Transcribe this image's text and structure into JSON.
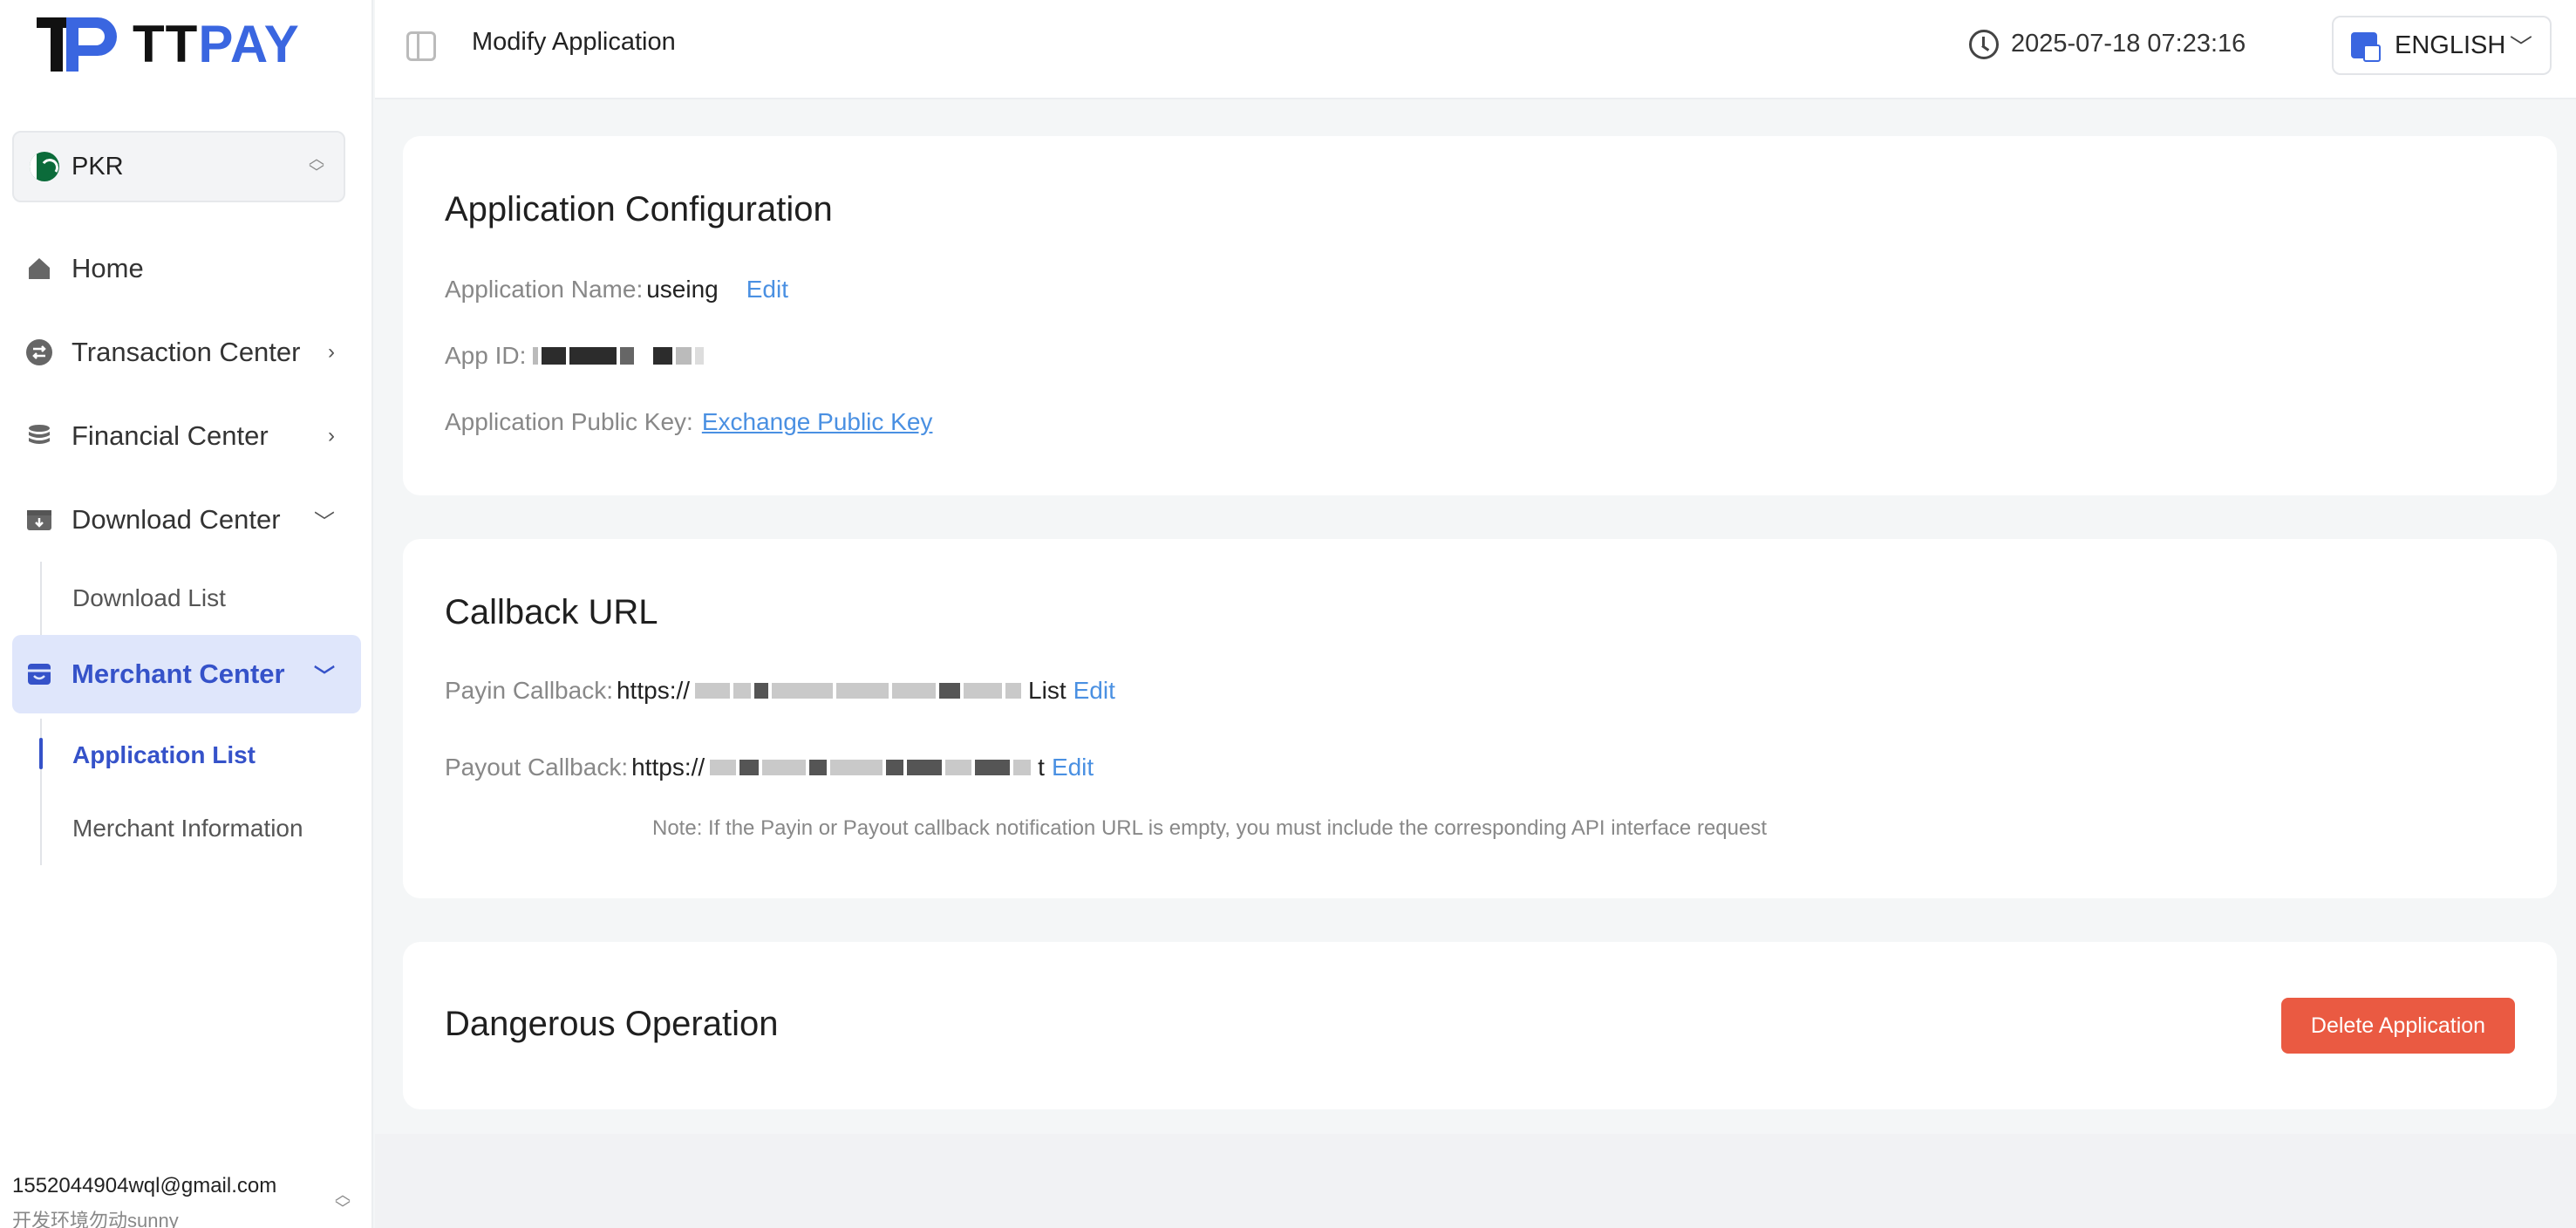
{
  "brand": {
    "name_dark": "TT",
    "name_accent": "PAY",
    "accent_color": "#3a66e0"
  },
  "sidebar": {
    "currency": {
      "label": "PKR",
      "icon": "pakistan-flag-icon"
    },
    "nav": {
      "home": {
        "label": "Home",
        "icon": "home-icon"
      },
      "transaction": {
        "label": "Transaction Center",
        "icon": "exchange-icon"
      },
      "financial": {
        "label": "Financial Center",
        "icon": "database-icon"
      },
      "download": {
        "label": "Download Center",
        "icon": "download-box-icon"
      },
      "download_list": {
        "label": "Download List"
      },
      "merchant": {
        "label": "Merchant Center",
        "icon": "store-icon"
      },
      "application_list": {
        "label": "Application List"
      },
      "merchant_info": {
        "label": "Merchant Information"
      }
    },
    "user": {
      "email": "1552044904wql@gmail.com",
      "subtitle": "开发环境勿动sunny"
    }
  },
  "topbar": {
    "title": "Modify Application",
    "datetime": "2025-07-18 07:23:16",
    "language": "ENGLISH"
  },
  "config": {
    "title": "Application Configuration",
    "name_label": "Application Name:",
    "name_value": "useing",
    "edit": "Edit",
    "appid_label": "App ID:",
    "pubkey_label": "Application Public Key:",
    "pubkey_link": "Exchange Public Key"
  },
  "callback": {
    "title": "Callback URL",
    "payin_label": "Payin Callback:",
    "payin_prefix": "https://",
    "payin_suffix": "List",
    "payout_label": "Payout Callback:",
    "payout_prefix": "https://",
    "payout_suffix": "t",
    "edit": "Edit",
    "note": "Note: If the Payin or Payout callback notification URL is empty, you must include the corresponding API interface request"
  },
  "danger": {
    "title": "Dangerous Operation",
    "delete_button": "Delete Application",
    "button_color": "#ea5a42"
  }
}
